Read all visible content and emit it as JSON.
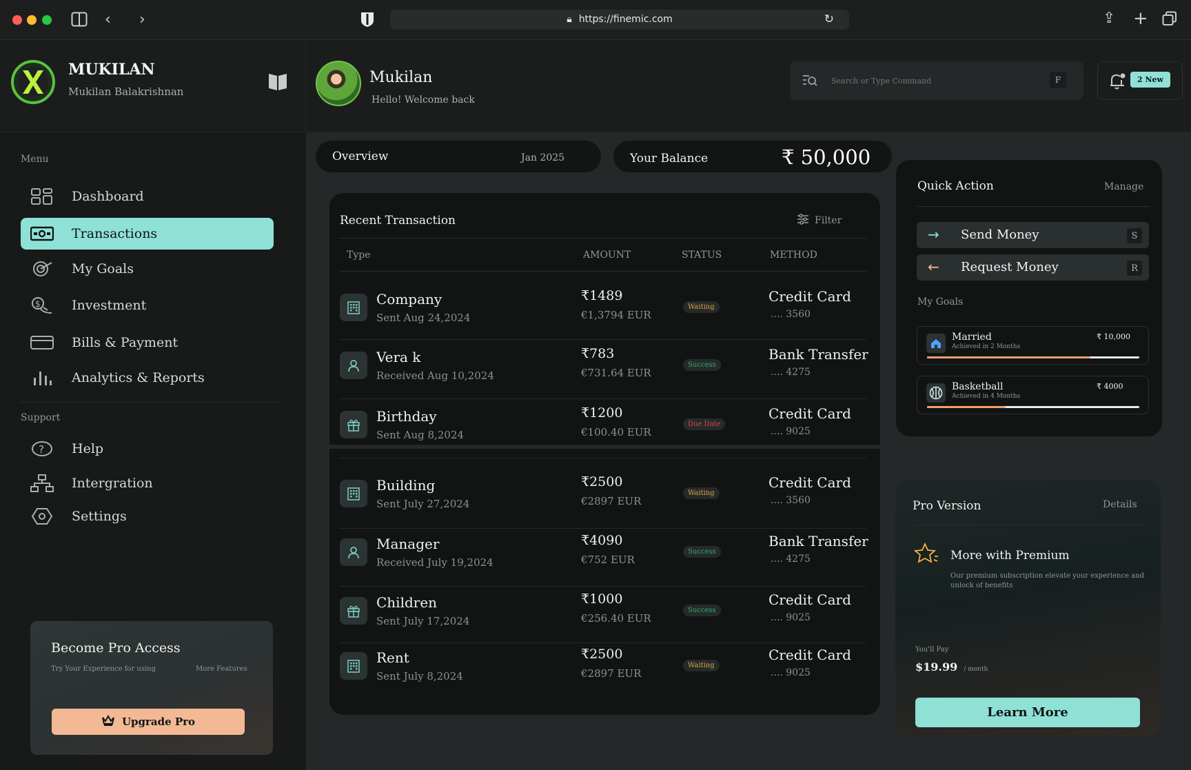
{
  "browser": {
    "url": "https://finemic.com",
    "colors": {
      "close": "#ff5f57",
      "minimize": "#febc2e",
      "zoom": "#28c840"
    }
  },
  "brand": {
    "name": "MUKILAN",
    "subtitle": "Mukilan Balakrishnan"
  },
  "user": {
    "name": "Mukilan",
    "greeting": "Hello! Welcome back"
  },
  "search": {
    "placeholder": "Search or Type Command",
    "shortcut": "F"
  },
  "notifications": {
    "badge": "2 New"
  },
  "menu": {
    "label": "Menu",
    "items": [
      {
        "label": "Dashboard",
        "icon": "dashboard-icon"
      },
      {
        "label": "Transactions",
        "icon": "cash-icon"
      },
      {
        "label": "My Goals",
        "icon": "target-icon"
      },
      {
        "label": "Investment",
        "icon": "investment-icon"
      },
      {
        "label": "Bills & Payment",
        "icon": "card-icon"
      },
      {
        "label": "Analytics & Reports",
        "icon": "bar-chart-icon"
      }
    ]
  },
  "support": {
    "label": "Support",
    "items": [
      {
        "label": "Help",
        "icon": "help-icon"
      },
      {
        "label": "Intergration",
        "icon": "sitemap-icon"
      },
      {
        "label": "Settings",
        "icon": "settings-icon"
      }
    ]
  },
  "promo": {
    "title": "Become Pro Access",
    "left_text": "Try Your Experience for using",
    "right_text": "More Features",
    "button": "Upgrade Pro"
  },
  "overview": {
    "label": "Overview",
    "date": "Jan 2025"
  },
  "balance": {
    "label": "Your Balance",
    "value": "₹ 50,000"
  },
  "transactions": {
    "title": "Recent Transaction",
    "filter": "Filter",
    "headers": {
      "type": "Type",
      "amount": "AMOUNT",
      "status": "STATUS",
      "method": "METHOD"
    },
    "rows": [
      {
        "name": "Company",
        "date": "Sent Aug 24,2024",
        "amount": "₹1489",
        "eur": "€1,3794 EUR",
        "status": "Waiting",
        "method": "Credit Card",
        "card": ".... 3560",
        "icon": "building-icon"
      },
      {
        "name": "Vera k",
        "date": "Received Aug 10,2024",
        "amount": "₹783",
        "eur": "€731.64 EUR",
        "status": "Success",
        "method": "Bank Transfer",
        "card": ".... 4275",
        "icon": "user-icon"
      },
      {
        "name": "Birthday",
        "date": "Sent Aug 8,2024",
        "amount": "₹1200",
        "eur": "€100.40 EUR",
        "status": "Due Date",
        "method": "Credit Card",
        "card": ".... 9025",
        "icon": "gift-icon"
      },
      {
        "name": "Building",
        "date": "Sent July 27,2024",
        "amount": "₹2500",
        "eur": "€2897 EUR",
        "status": "Waiting",
        "method": "Credit Card",
        "card": ".... 3560",
        "icon": "building-icon"
      },
      {
        "name": "Manager",
        "date": "Received July 19,2024",
        "amount": "₹4090",
        "eur": "€752 EUR",
        "status": "Success",
        "method": "Bank Transfer",
        "card": ".... 4275",
        "icon": "user-icon"
      },
      {
        "name": "Children",
        "date": "Sent July 17,2024",
        "amount": "₹1000",
        "eur": "€256.40 EUR",
        "status": "Success",
        "method": "Credit Card",
        "card": ".... 9025",
        "icon": "gift-icon"
      },
      {
        "name": "Rent",
        "date": "Sent July 8,2024",
        "amount": "₹2500",
        "eur": "€2897 EUR",
        "status": "Waiting",
        "method": "Credit Card",
        "card": ".... 9025",
        "icon": "building-icon"
      }
    ],
    "status_colors": {
      "Waiting": "#d9a441",
      "Success": "#2fb06a",
      "Due Date": "#e0443b"
    }
  },
  "quick_action": {
    "title": "Quick Action",
    "manage": "Manage",
    "send": {
      "label": "Send Money",
      "key": "S"
    },
    "request": {
      "label": "Request Money",
      "key": "R"
    },
    "goals_label": "My Goals",
    "goals": [
      {
        "name": "Married",
        "sub": "Achieved in 2 Months",
        "amount": "₹ 10,000",
        "progress": 0.77,
        "icon": "home-icon"
      },
      {
        "name": "Basketball",
        "sub": "Achieved in 4 Months",
        "amount": "₹ 4000",
        "progress": 0.37,
        "icon": "basketball-icon"
      }
    ]
  },
  "pro": {
    "title": "Pro Version",
    "details": "Details",
    "headline": "More with Premium",
    "desc": "Our premium subscription elevate your experience and unlock of benefits",
    "pay_label": "You'll Pay",
    "price": "$19.99",
    "period": "/ month",
    "button": "Learn More"
  },
  "accent": "#8fe1d6"
}
